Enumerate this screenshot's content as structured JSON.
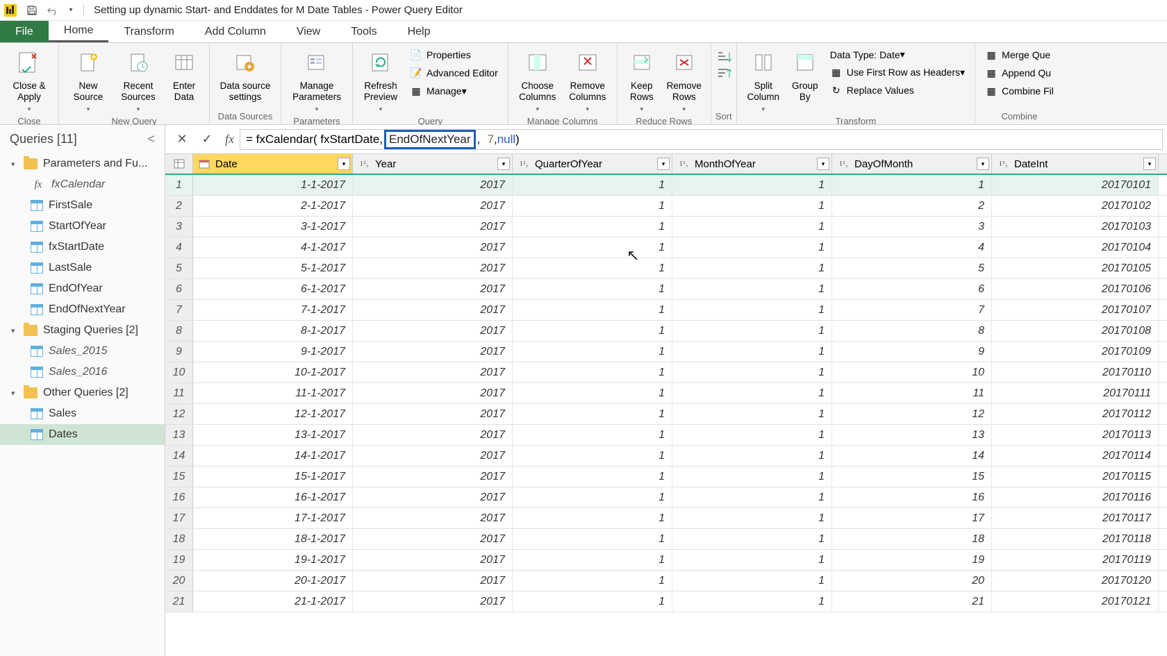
{
  "title": "Setting up dynamic Start- and Enddates for M Date Tables - Power Query Editor",
  "menutabs": {
    "file": "File",
    "home": "Home",
    "transform": "Transform",
    "addcolumn": "Add Column",
    "view": "View",
    "tools": "Tools",
    "help": "Help"
  },
  "ribbon": {
    "close": {
      "close_apply": "Close &\nApply",
      "group": "Close"
    },
    "newquery": {
      "new_source": "New\nSource",
      "recent_sources": "Recent\nSources",
      "enter_data": "Enter\nData",
      "group": "New Query"
    },
    "datasources": {
      "settings": "Data source\nsettings",
      "group": "Data Sources"
    },
    "parameters": {
      "manage": "Manage\nParameters",
      "group": "Parameters"
    },
    "query": {
      "refresh": "Refresh\nPreview",
      "properties": "Properties",
      "advanced": "Advanced Editor",
      "manage": "Manage",
      "group": "Query"
    },
    "managecols": {
      "choose": "Choose\nColumns",
      "remove": "Remove\nColumns",
      "group": "Manage Columns"
    },
    "reducerows": {
      "keep": "Keep\nRows",
      "remove": "Remove\nRows",
      "group": "Reduce Rows"
    },
    "sort": {
      "group": "Sort"
    },
    "transform": {
      "split": "Split\nColumn",
      "groupby": "Group\nBy",
      "datatype": "Data Type: Date",
      "firstrow": "Use First Row as Headers",
      "replace": "Replace Values",
      "group": "Transform"
    },
    "combine": {
      "merge": "Merge Que",
      "append": "Append Qu",
      "combinefiles": "Combine Fil",
      "group": "Combine"
    }
  },
  "queries": {
    "header": "Queries [11]",
    "folder1": "Parameters and Fu...",
    "items1": [
      "fxCalendar",
      "FirstSale",
      "StartOfYear",
      "fxStartDate",
      "LastSale",
      "EndOfYear",
      "EndOfNextYear"
    ],
    "folder2": "Staging Queries [2]",
    "items2": [
      "Sales_2015",
      "Sales_2016"
    ],
    "folder3": "Other Queries [2]",
    "items3": [
      "Sales",
      "Dates"
    ]
  },
  "formula": {
    "prefix": "= fxCalendar( fxStartDate,",
    "highlighted": "EndOfNextYear",
    "mid": ",",
    "num": "7",
    "comma2": ", ",
    "nullkw": "null",
    "suffix": ")"
  },
  "columns": [
    "Date",
    "Year",
    "QuarterOfYear",
    "MonthOfYear",
    "DayOfMonth",
    "DateInt"
  ],
  "rows": [
    {
      "n": 1,
      "date": "1-1-2017",
      "year": 2017,
      "q": 1,
      "m": 1,
      "d": 1,
      "di": 20170101
    },
    {
      "n": 2,
      "date": "2-1-2017",
      "year": 2017,
      "q": 1,
      "m": 1,
      "d": 2,
      "di": 20170102
    },
    {
      "n": 3,
      "date": "3-1-2017",
      "year": 2017,
      "q": 1,
      "m": 1,
      "d": 3,
      "di": 20170103
    },
    {
      "n": 4,
      "date": "4-1-2017",
      "year": 2017,
      "q": 1,
      "m": 1,
      "d": 4,
      "di": 20170104
    },
    {
      "n": 5,
      "date": "5-1-2017",
      "year": 2017,
      "q": 1,
      "m": 1,
      "d": 5,
      "di": 20170105
    },
    {
      "n": 6,
      "date": "6-1-2017",
      "year": 2017,
      "q": 1,
      "m": 1,
      "d": 6,
      "di": 20170106
    },
    {
      "n": 7,
      "date": "7-1-2017",
      "year": 2017,
      "q": 1,
      "m": 1,
      "d": 7,
      "di": 20170107
    },
    {
      "n": 8,
      "date": "8-1-2017",
      "year": 2017,
      "q": 1,
      "m": 1,
      "d": 8,
      "di": 20170108
    },
    {
      "n": 9,
      "date": "9-1-2017",
      "year": 2017,
      "q": 1,
      "m": 1,
      "d": 9,
      "di": 20170109
    },
    {
      "n": 10,
      "date": "10-1-2017",
      "year": 2017,
      "q": 1,
      "m": 1,
      "d": 10,
      "di": 20170110
    },
    {
      "n": 11,
      "date": "11-1-2017",
      "year": 2017,
      "q": 1,
      "m": 1,
      "d": 11,
      "di": 20170111
    },
    {
      "n": 12,
      "date": "12-1-2017",
      "year": 2017,
      "q": 1,
      "m": 1,
      "d": 12,
      "di": 20170112
    },
    {
      "n": 13,
      "date": "13-1-2017",
      "year": 2017,
      "q": 1,
      "m": 1,
      "d": 13,
      "di": 20170113
    },
    {
      "n": 14,
      "date": "14-1-2017",
      "year": 2017,
      "q": 1,
      "m": 1,
      "d": 14,
      "di": 20170114
    },
    {
      "n": 15,
      "date": "15-1-2017",
      "year": 2017,
      "q": 1,
      "m": 1,
      "d": 15,
      "di": 20170115
    },
    {
      "n": 16,
      "date": "16-1-2017",
      "year": 2017,
      "q": 1,
      "m": 1,
      "d": 16,
      "di": 20170116
    },
    {
      "n": 17,
      "date": "17-1-2017",
      "year": 2017,
      "q": 1,
      "m": 1,
      "d": 17,
      "di": 20170117
    },
    {
      "n": 18,
      "date": "18-1-2017",
      "year": 2017,
      "q": 1,
      "m": 1,
      "d": 18,
      "di": 20170118
    },
    {
      "n": 19,
      "date": "19-1-2017",
      "year": 2017,
      "q": 1,
      "m": 1,
      "d": 19,
      "di": 20170119
    },
    {
      "n": 20,
      "date": "20-1-2017",
      "year": 2017,
      "q": 1,
      "m": 1,
      "d": 20,
      "di": 20170120
    },
    {
      "n": 21,
      "date": "21-1-2017",
      "year": 2017,
      "q": 1,
      "m": 1,
      "d": 21,
      "di": 20170121
    }
  ]
}
